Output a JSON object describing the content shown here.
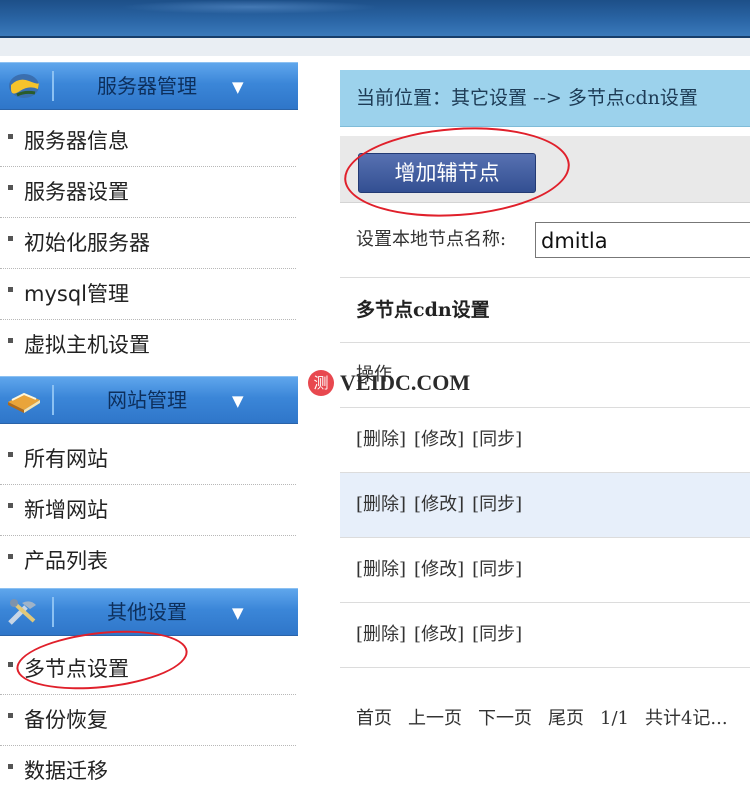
{
  "sidebar": {
    "sections": [
      {
        "title": "服务器管理",
        "icon": "globe-icon",
        "items": [
          "服务器信息",
          "服务器设置",
          "初始化服务器",
          "mysql管理",
          "虚拟主机设置"
        ]
      },
      {
        "title": "网站管理",
        "icon": "book-icon",
        "items": [
          "所有网站",
          "新增网站",
          "产品列表"
        ]
      },
      {
        "title": "其他设置",
        "icon": "tools-icon",
        "items": [
          "多节点设置",
          "备份恢复",
          "数据迁移"
        ]
      }
    ]
  },
  "main": {
    "breadcrumb": "当前位置：其它设置 --> 多节点cdn设置",
    "add_button": "增加辅节点",
    "local_node_label": "设置本地节点名称:",
    "local_node_value": "dmitla",
    "section_title": "多节点cdn设置",
    "table_header": "操作",
    "actions": {
      "delete": "[删除]",
      "edit": "[修改]",
      "sync": "[同步]"
    },
    "pager": {
      "first": "首页",
      "prev": "上一页",
      "next": "下一页",
      "last": "尾页",
      "page": "1/1",
      "total": "共计4记..."
    }
  },
  "watermark": "VEIDC.COM",
  "colors": {
    "accent_blue": "#3b86d8",
    "breadcrumb_bg": "#9cd2ec",
    "button_bg": "#334f92",
    "annotation_red": "#e0202b"
  }
}
